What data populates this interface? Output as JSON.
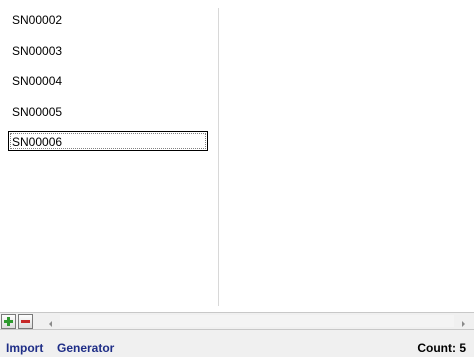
{
  "list": {
    "items": [
      {
        "label": "SN00002"
      },
      {
        "label": "SN00003"
      },
      {
        "label": "SN00004"
      },
      {
        "label": "SN00005"
      },
      {
        "label": "SN00006",
        "selected": true
      }
    ]
  },
  "toolbar": {
    "add_icon": "plus-icon",
    "remove_icon": "minus-icon",
    "add_color": "#2e9a2e",
    "remove_color": "#c62828"
  },
  "status": {
    "import_label": "Import",
    "generator_label": "Generator",
    "count_label": "Count: 5"
  }
}
